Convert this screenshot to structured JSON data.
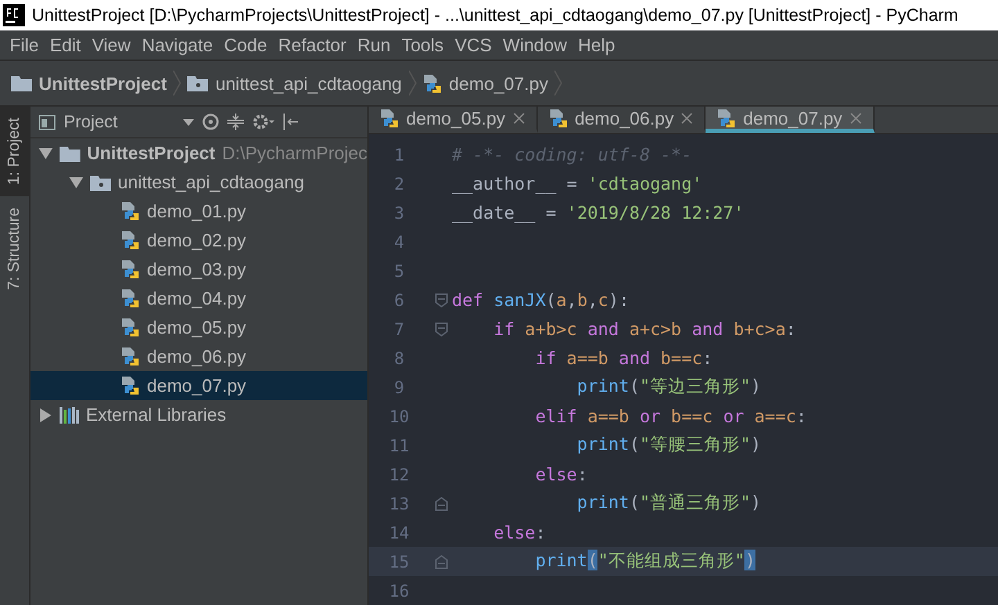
{
  "window": {
    "title": "UnittestProject [D:\\PycharmProjects\\UnittestProject] - ...\\unittest_api_cdtaogang\\demo_07.py [UnittestProject] - PyCharm"
  },
  "menu": [
    "File",
    "Edit",
    "View",
    "Navigate",
    "Code",
    "Refactor",
    "Run",
    "Tools",
    "VCS",
    "Window",
    "Help"
  ],
  "breadcrumb": [
    {
      "kind": "project",
      "label": "UnittestProject"
    },
    {
      "kind": "folder",
      "label": "unittest_api_cdtaogang"
    },
    {
      "kind": "file",
      "label": "demo_07.py"
    }
  ],
  "tool_strip": [
    {
      "label": "1: Project",
      "selected": true
    },
    {
      "label": "7: Structure",
      "selected": false
    }
  ],
  "project_panel": {
    "view": "Project",
    "tree": [
      {
        "kind": "project",
        "label": "UnittestProject",
        "hint": "D:\\PycharmProjec",
        "expanded": true,
        "selected": false,
        "children": [
          {
            "kind": "folder",
            "label": "unittest_api_cdtaogang",
            "expanded": true,
            "selected": false,
            "children": [
              {
                "kind": "file",
                "label": "demo_01.py",
                "selected": false
              },
              {
                "kind": "file",
                "label": "demo_02.py",
                "selected": false
              },
              {
                "kind": "file",
                "label": "demo_03.py",
                "selected": false
              },
              {
                "kind": "file",
                "label": "demo_04.py",
                "selected": false
              },
              {
                "kind": "file",
                "label": "demo_05.py",
                "selected": false
              },
              {
                "kind": "file",
                "label": "demo_06.py",
                "selected": false
              },
              {
                "kind": "file",
                "label": "demo_07.py",
                "selected": true
              }
            ]
          }
        ]
      },
      {
        "kind": "library",
        "label": "External Libraries",
        "expanded": false,
        "selected": false
      }
    ]
  },
  "tabs": [
    {
      "label": "demo_05.py",
      "selected": false
    },
    {
      "label": "demo_06.py",
      "selected": false
    },
    {
      "label": "demo_07.py",
      "selected": true
    }
  ],
  "editor": {
    "lines": [
      {
        "number": "1",
        "current": false,
        "fold_start": false,
        "fold_end": false,
        "tokens": [
          {
            "kind": "comment",
            "text": "# -*- coding: utf-8 -*-"
          }
        ]
      },
      {
        "number": "2",
        "current": false,
        "fold_start": false,
        "fold_end": false,
        "tokens": [
          {
            "kind": "plain",
            "text": "__author__ = "
          },
          {
            "kind": "string",
            "text": "'cdtaogang'"
          }
        ]
      },
      {
        "number": "3",
        "current": false,
        "fold_start": false,
        "fold_end": false,
        "tokens": [
          {
            "kind": "plain",
            "text": "__date__ = "
          },
          {
            "kind": "string",
            "text": "'2019/8/28 12:27'"
          }
        ]
      },
      {
        "number": "4",
        "current": false,
        "fold_start": false,
        "fold_end": false
      },
      {
        "number": "5",
        "current": false,
        "fold_start": false,
        "fold_end": false
      },
      {
        "number": "6",
        "current": false,
        "fold_start": true,
        "fold_end": false,
        "tokens": [
          {
            "kind": "keyword",
            "text": "def"
          },
          {
            "kind": "function",
            "text": " sanJX"
          },
          {
            "kind": "plain",
            "text": "("
          },
          {
            "kind": "name",
            "text": "a"
          },
          {
            "kind": "plain",
            "text": ","
          },
          {
            "kind": "name",
            "text": "b"
          },
          {
            "kind": "plain",
            "text": ","
          },
          {
            "kind": "name",
            "text": "c"
          },
          {
            "kind": "plain",
            "text": "):"
          }
        ]
      },
      {
        "number": "7",
        "current": false,
        "fold_start": true,
        "fold_end": false,
        "tokens": [
          {
            "kind": "keyword",
            "text": "    if"
          },
          {
            "kind": "name",
            "text": " a+b>c "
          },
          {
            "kind": "keyword",
            "text": "and"
          },
          {
            "kind": "name",
            "text": " a+c>b "
          },
          {
            "kind": "keyword",
            "text": "and"
          },
          {
            "kind": "name",
            "text": " b+c>a"
          },
          {
            "kind": "plain",
            "text": ":"
          }
        ]
      },
      {
        "number": "8",
        "current": false,
        "fold_start": false,
        "fold_end": false,
        "tokens": [
          {
            "kind": "keyword",
            "text": "        if"
          },
          {
            "kind": "name",
            "text": " a==b "
          },
          {
            "kind": "keyword",
            "text": "and"
          },
          {
            "kind": "name",
            "text": " b==c"
          },
          {
            "kind": "plain",
            "text": ":"
          }
        ]
      },
      {
        "number": "9",
        "current": false,
        "fold_start": false,
        "fold_end": false,
        "tokens": [
          {
            "kind": "function",
            "text": "            print"
          },
          {
            "kind": "plain",
            "text": "("
          },
          {
            "kind": "string",
            "text": "\"等边三角形\""
          },
          {
            "kind": "plain",
            "text": ")"
          }
        ]
      },
      {
        "number": "10",
        "current": false,
        "fold_start": false,
        "fold_end": false,
        "tokens": [
          {
            "kind": "keyword",
            "text": "        elif"
          },
          {
            "kind": "name",
            "text": " a==b "
          },
          {
            "kind": "keyword",
            "text": "or"
          },
          {
            "kind": "name",
            "text": " b==c "
          },
          {
            "kind": "keyword",
            "text": "or"
          },
          {
            "kind": "name",
            "text": " a==c"
          },
          {
            "kind": "plain",
            "text": ":"
          }
        ]
      },
      {
        "number": "11",
        "current": false,
        "fold_start": false,
        "fold_end": false,
        "tokens": [
          {
            "kind": "function",
            "text": "            print"
          },
          {
            "kind": "plain",
            "text": "("
          },
          {
            "kind": "string",
            "text": "\"等腰三角形\""
          },
          {
            "kind": "plain",
            "text": ")"
          }
        ]
      },
      {
        "number": "12",
        "current": false,
        "fold_start": false,
        "fold_end": false,
        "tokens": [
          {
            "kind": "keyword",
            "text": "        else"
          },
          {
            "kind": "plain",
            "text": ":"
          }
        ]
      },
      {
        "number": "13",
        "current": false,
        "fold_start": false,
        "fold_end": true,
        "tokens": [
          {
            "kind": "function",
            "text": "            print"
          },
          {
            "kind": "plain",
            "text": "("
          },
          {
            "kind": "string",
            "text": "\"普通三角形\""
          },
          {
            "kind": "plain",
            "text": ")"
          }
        ]
      },
      {
        "number": "14",
        "current": false,
        "fold_start": false,
        "fold_end": false,
        "tokens": [
          {
            "kind": "keyword",
            "text": "    else"
          },
          {
            "kind": "plain",
            "text": ":"
          }
        ]
      },
      {
        "number": "15",
        "current": true,
        "fold_start": false,
        "fold_end": true,
        "tokens": [
          {
            "kind": "function",
            "text": "        print"
          },
          {
            "kind": "match",
            "text": "("
          },
          {
            "kind": "string",
            "text": "\"不能组成三角形\""
          },
          {
            "kind": "match",
            "text": ")"
          }
        ]
      },
      {
        "number": "16",
        "current": false,
        "fold_start": false,
        "fold_end": false
      }
    ]
  }
}
